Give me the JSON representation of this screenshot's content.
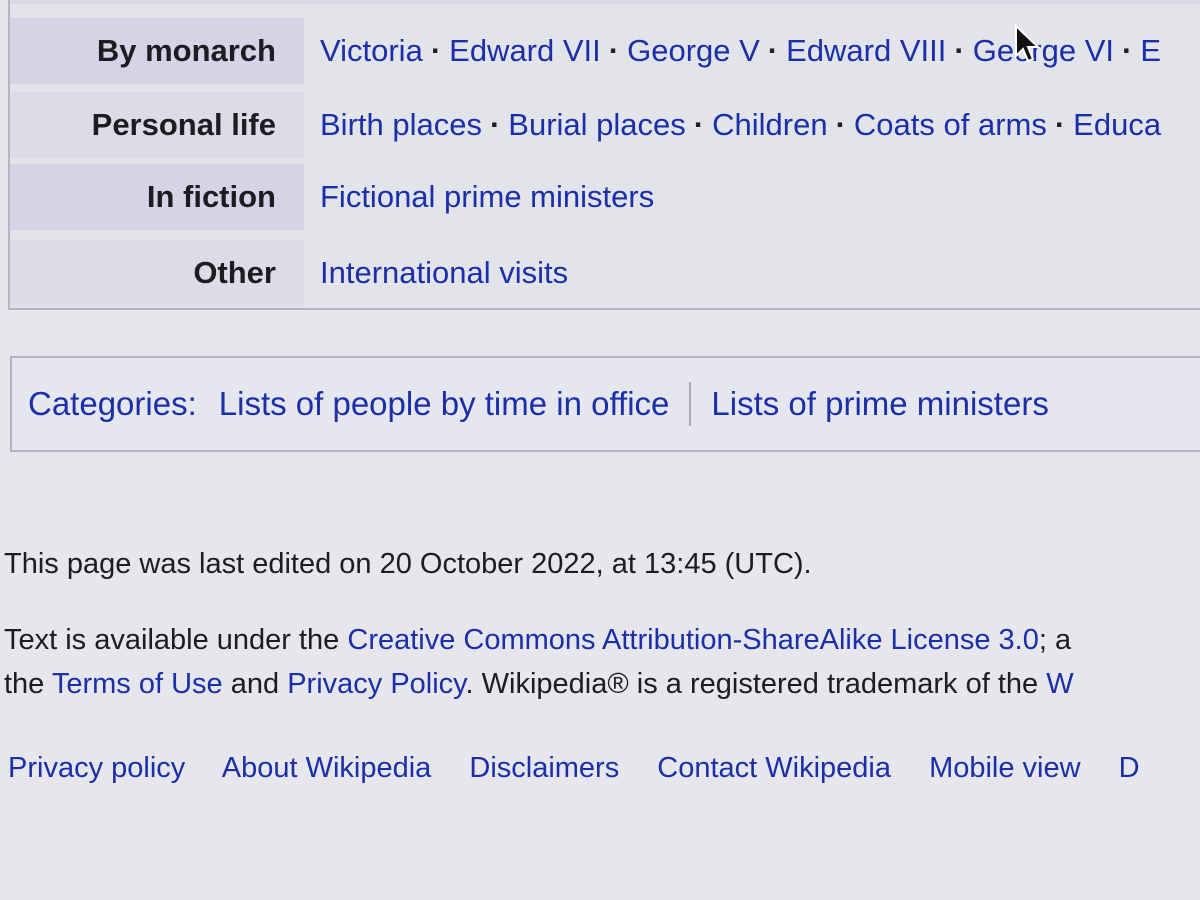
{
  "navbox": {
    "rows": [
      {
        "group": "By monarch",
        "items": [
          "Victoria",
          "Edward VII",
          "George V",
          "Edward VIII",
          "George VI",
          "E"
        ]
      },
      {
        "group": "Personal life",
        "items": [
          "Birth places",
          "Burial places",
          "Children",
          "Coats of arms",
          "Educa"
        ]
      },
      {
        "group": "In fiction",
        "items": [
          "Fictional prime ministers"
        ]
      },
      {
        "group": "Other",
        "items": [
          "International visits"
        ]
      }
    ],
    "separator": "·"
  },
  "categories": {
    "label": "Categories:",
    "items": [
      "Lists of people by time in office",
      "Lists of prime ministers"
    ]
  },
  "footer": {
    "last_edited": "This page was last edited on 20 October 2022, at 13:45 (UTC).",
    "license_prefix": "Text is available under the ",
    "license_link": "Creative Commons Attribution-ShareAlike License 3.0",
    "license_suffix": "; a",
    "line2_prefix": "the ",
    "terms_link": "Terms of Use",
    "line2_and": " and ",
    "privacy_link": "Privacy Policy",
    "line2_suffix": ". Wikipedia® is a registered trademark of the ",
    "line2_tail": "W",
    "links": [
      "Privacy policy",
      "About Wikipedia",
      "Disclaimers",
      "Contact Wikipedia",
      "Mobile view",
      "D"
    ]
  },
  "colors": {
    "link": "#1a2fa8",
    "text": "#202122",
    "group_bg": "#d4d4e6"
  }
}
